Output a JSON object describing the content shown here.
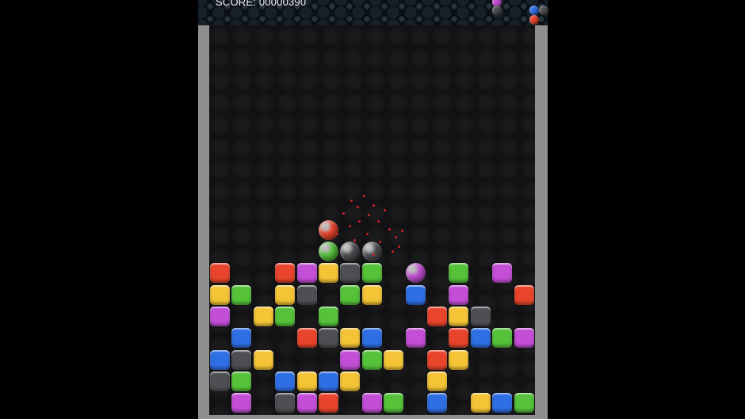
{
  "hud": {
    "score_text": "SCORE: 00000390"
  },
  "colors": {
    "red": "#e8452c",
    "purple": "#c34fd6",
    "yellow": "#f4c436",
    "green": "#55c23a",
    "blue": "#2f6fe4",
    "gray": "#4d4f52",
    "spark": "#d0202a"
  },
  "board": {
    "columns": 15,
    "rows": 18,
    "settled_blocks": [
      {
        "r": 11,
        "c": 0,
        "color": "red"
      },
      {
        "r": 11,
        "c": 3,
        "color": "red"
      },
      {
        "r": 11,
        "c": 4,
        "color": "purple"
      },
      {
        "r": 11,
        "c": 5,
        "color": "yellow"
      },
      {
        "r": 11,
        "c": 6,
        "color": "gray"
      },
      {
        "r": 11,
        "c": 7,
        "color": "green"
      },
      {
        "r": 11,
        "c": 11,
        "color": "green"
      },
      {
        "r": 11,
        "c": 13,
        "color": "purple"
      },
      {
        "r": 12,
        "c": 0,
        "color": "yellow"
      },
      {
        "r": 12,
        "c": 1,
        "color": "green"
      },
      {
        "r": 12,
        "c": 3,
        "color": "yellow"
      },
      {
        "r": 12,
        "c": 4,
        "color": "gray"
      },
      {
        "r": 12,
        "c": 6,
        "color": "green"
      },
      {
        "r": 12,
        "c": 7,
        "color": "yellow"
      },
      {
        "r": 12,
        "c": 9,
        "color": "blue"
      },
      {
        "r": 12,
        "c": 11,
        "color": "purple"
      },
      {
        "r": 12,
        "c": 14,
        "color": "red"
      },
      {
        "r": 13,
        "c": 0,
        "color": "purple"
      },
      {
        "r": 13,
        "c": 2,
        "color": "yellow"
      },
      {
        "r": 13,
        "c": 3,
        "color": "green"
      },
      {
        "r": 13,
        "c": 5,
        "color": "green"
      },
      {
        "r": 13,
        "c": 10,
        "color": "red"
      },
      {
        "r": 13,
        "c": 11,
        "color": "yellow"
      },
      {
        "r": 13,
        "c": 12,
        "color": "gray"
      },
      {
        "r": 14,
        "c": 1,
        "color": "blue"
      },
      {
        "r": 14,
        "c": 4,
        "color": "red"
      },
      {
        "r": 14,
        "c": 5,
        "color": "gray"
      },
      {
        "r": 14,
        "c": 6,
        "color": "yellow"
      },
      {
        "r": 14,
        "c": 7,
        "color": "blue"
      },
      {
        "r": 14,
        "c": 9,
        "color": "purple"
      },
      {
        "r": 14,
        "c": 11,
        "color": "red"
      },
      {
        "r": 14,
        "c": 12,
        "color": "blue"
      },
      {
        "r": 14,
        "c": 13,
        "color": "green"
      },
      {
        "r": 14,
        "c": 14,
        "color": "purple"
      },
      {
        "r": 15,
        "c": 0,
        "color": "blue"
      },
      {
        "r": 15,
        "c": 1,
        "color": "gray"
      },
      {
        "r": 15,
        "c": 2,
        "color": "yellow"
      },
      {
        "r": 15,
        "c": 6,
        "color": "purple"
      },
      {
        "r": 15,
        "c": 7,
        "color": "green"
      },
      {
        "r": 15,
        "c": 8,
        "color": "yellow"
      },
      {
        "r": 15,
        "c": 10,
        "color": "red"
      },
      {
        "r": 15,
        "c": 11,
        "color": "yellow"
      },
      {
        "r": 16,
        "c": 0,
        "color": "gray"
      },
      {
        "r": 16,
        "c": 1,
        "color": "green"
      },
      {
        "r": 16,
        "c": 3,
        "color": "blue"
      },
      {
        "r": 16,
        "c": 4,
        "color": "yellow"
      },
      {
        "r": 16,
        "c": 5,
        "color": "blue"
      },
      {
        "r": 16,
        "c": 6,
        "color": "yellow"
      },
      {
        "r": 16,
        "c": 10,
        "color": "yellow"
      },
      {
        "r": 17,
        "c": 1,
        "color": "purple"
      },
      {
        "r": 17,
        "c": 3,
        "color": "gray"
      },
      {
        "r": 17,
        "c": 4,
        "color": "purple"
      },
      {
        "r": 17,
        "c": 5,
        "color": "red"
      },
      {
        "r": 17,
        "c": 7,
        "color": "purple"
      },
      {
        "r": 17,
        "c": 8,
        "color": "green"
      },
      {
        "r": 17,
        "c": 10,
        "color": "blue"
      },
      {
        "r": 17,
        "c": 12,
        "color": "yellow"
      },
      {
        "r": 17,
        "c": 13,
        "color": "blue"
      },
      {
        "r": 17,
        "c": 14,
        "color": "green"
      }
    ],
    "balls": [
      {
        "r": 9,
        "c": 5,
        "color": "red"
      },
      {
        "r": 10,
        "c": 5,
        "color": "green"
      },
      {
        "r": 10,
        "c": 6,
        "color": "gray"
      },
      {
        "r": 10,
        "c": 7,
        "color": "gray"
      },
      {
        "r": 11,
        "c": 9,
        "color": "purple"
      }
    ]
  },
  "next_piece": [
    {
      "color": "purple"
    },
    {
      "color": "gray"
    },
    {
      "color": "blue"
    },
    {
      "color": "gray"
    },
    {
      "color": "red"
    }
  ]
}
